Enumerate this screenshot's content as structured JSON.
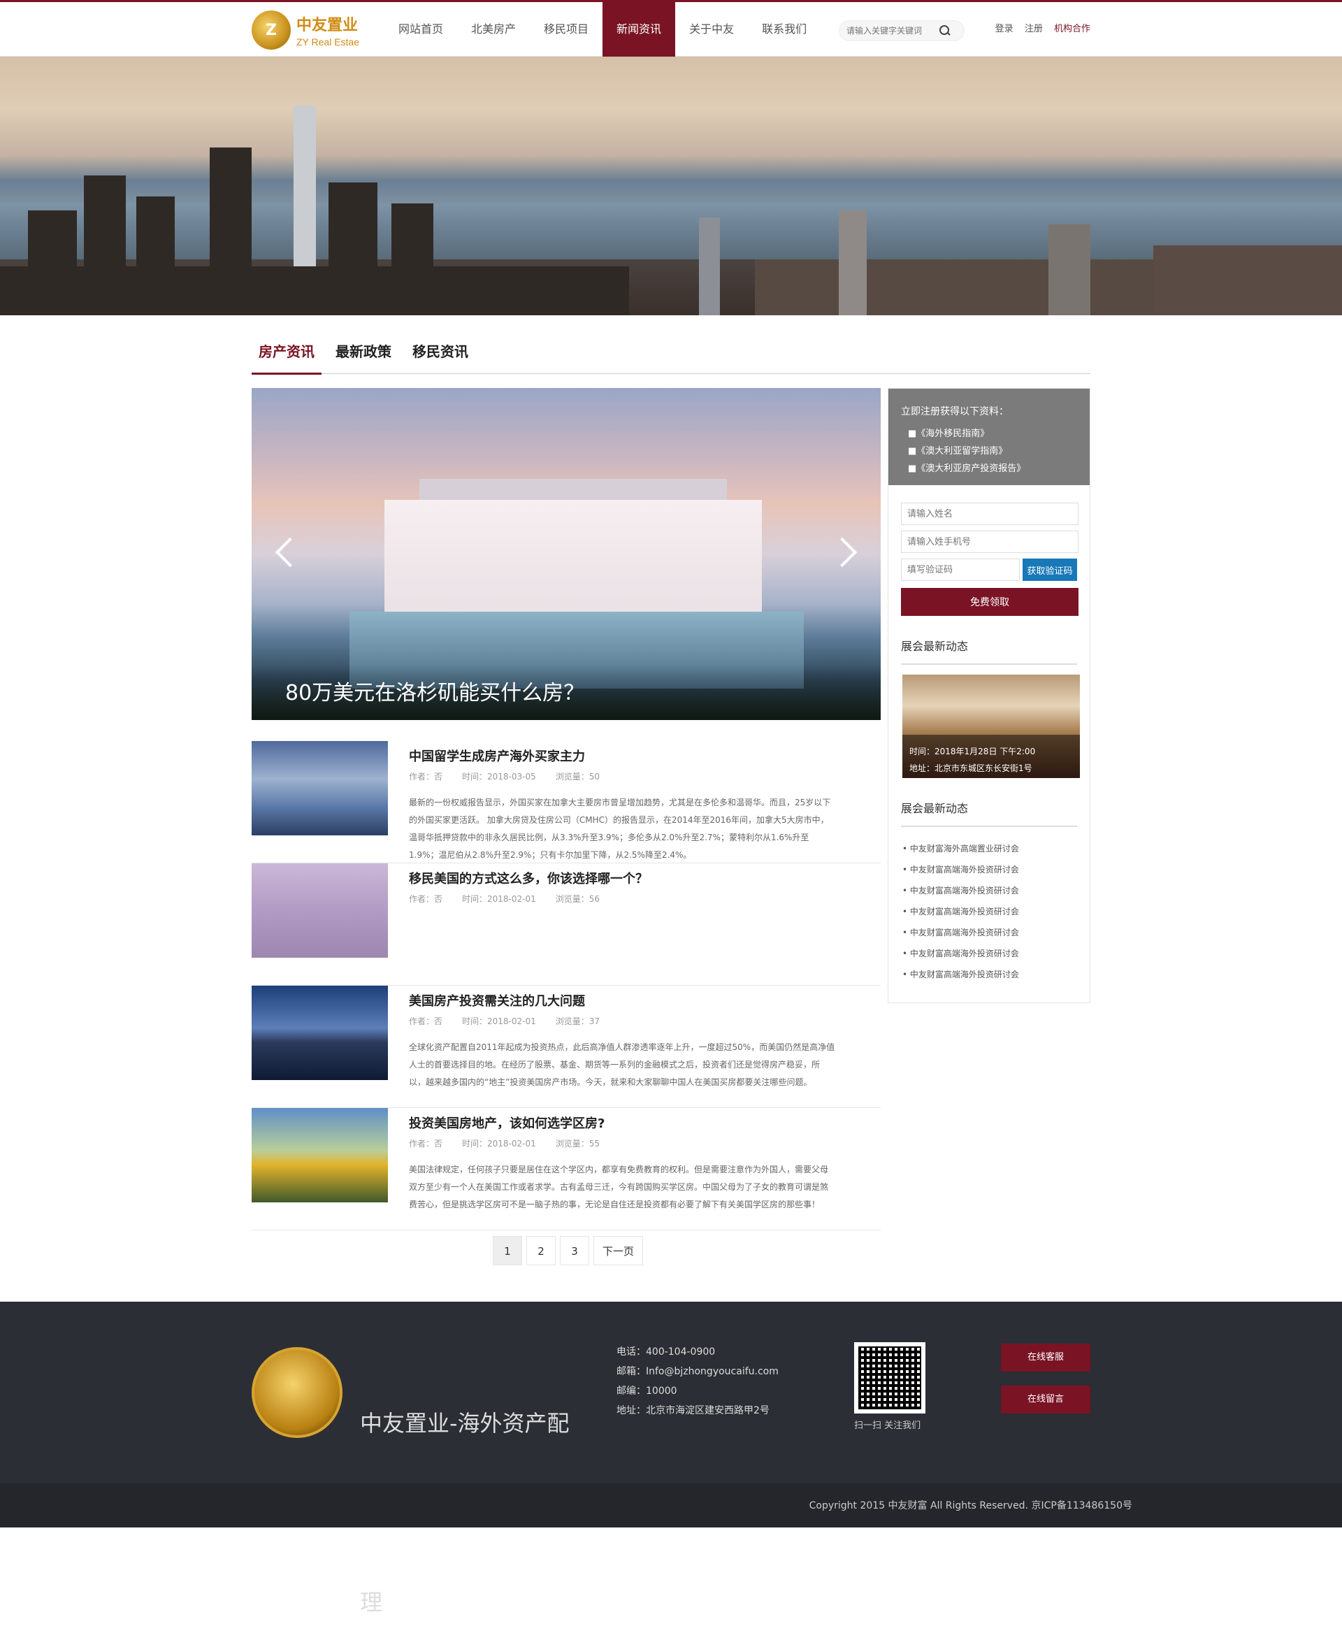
{
  "header": {
    "logo_cn": "中友置业",
    "logo_en": "ZY Real Estae",
    "nav": [
      "网站首页",
      "北美房产",
      "移民项目",
      "新闻资讯",
      "关于中友",
      "联系我们"
    ],
    "search_placeholder": "请输入关键字关键词",
    "login": "登录",
    "register": "注册",
    "partner": "机构合作"
  },
  "tabs": [
    "房产资讯",
    "最新政策",
    "移民资讯"
  ],
  "slider": {
    "caption": "80万美元在洛杉矶能买什么房？"
  },
  "news": [
    {
      "title": "中国留学生成房产海外买家主力",
      "author": "作者：否",
      "date": "时间：2018-03-05",
      "views": "浏览量：50",
      "desc": "最新的一份权威报告显示，外国买家在加拿大主要房市曾呈增加趋势，尤其是在多伦多和温哥华。而且，25岁以下的外国买家更活跃。 加拿大房贷及住房公司（CMHC）的报告显示，在2014年至2016年间，加拿大5大房市中，温哥华抵押贷款中的非永久居民比例，从3.3%升至3.9%；多伦多从2.0%升至2.7%；蒙特利尔从1.6%升至1.9%；温尼伯从2.8%升至2.9%；只有卡尔加里下降，从2.5%降至2.4%。"
    },
    {
      "title": "移民美国的方式这么多，你该选择哪一个？",
      "author": "作者：否",
      "date": "时间：2018-02-01",
      "views": "浏览量：56",
      "desc": ""
    },
    {
      "title": "美国房产投资需关注的几大问题",
      "author": "作者：否",
      "date": "时间：2018-02-01",
      "views": "浏览量：37",
      "desc": "全球化资产配置自2011年起成为投资热点，此后高净值人群渗透率逐年上升，一度超过50%，而美国仍然是高净值人士的首要选择目的地。在经历了股票、基金、期货等一系列的金融模式之后，投资者们还是觉得房产稳妥，所以，越来越多国内的“地主”投资美国房产市场。今天，就来和大家聊聊中国人在美国买房都要关注哪些问题。"
    },
    {
      "title": "投资美国房地产，该如何选学区房?",
      "author": "作者：否",
      "date": "时间：2018-02-01",
      "views": "浏览量：55",
      "desc": "美国法律规定，任何孩子只要是居住在这个学区内，都享有免费教育的权利。但是需要注意作为外国人，需要父母双方至少有一个人在美国工作或者求学。古有孟母三迁，今有跨国购买学区房。中国父母为了子女的教育可谓是煞费苦心，但是挑选学区房可不是一脑子热的事，无论是自住还是投资都有必要了解下有关美国学区房的那些事！"
    }
  ],
  "pager": [
    "1",
    "2",
    "3",
    "下一页"
  ],
  "side": {
    "promo_title": "立即注册获得以下资料：",
    "promo_items": [
      "■《海外移民指南》",
      "■《澳大利亚留学指南》",
      "■《澳大利亚房产投资报告》"
    ],
    "name_placeholder": "请输入姓名",
    "phone_placeholder": "请输入姓手机号",
    "code_placeholder": "填写验证码",
    "code_btn": "获取验证码",
    "submit": "免费领取",
    "expo_title": "展会最新动态",
    "expo_time": "时间：2018年1月28日 下午2:00",
    "expo_addr": "地址：北京市东城区东长安街1号",
    "links_title": "展会最新动态",
    "links": [
      "中友财富海外高端置业研讨会",
      "中友财富高端海外投资研讨会",
      "中友财富高端海外投资研讨会",
      "中友财富高端海外投资研讨会",
      "中友财富高端海外投资研讨会",
      "中友财富高端海外投资研讨会",
      "中友财富高端海外投资研讨会"
    ]
  },
  "footer": {
    "slogan": "中友置业-海外资产配置，移民留学，财富管理",
    "phone": "电话：400-104-0900",
    "email": "邮箱：Info@bjzhongyoucaifu.com",
    "zip": "邮编：10000",
    "addr": "地址：北京市海淀区建安西路甲2号",
    "qr_text": "扫一扫 关注我们",
    "service": "在线客服",
    "message": "在线留言",
    "copyright": "Copyright 2015 中友财富 All Rights Reserved. 京ICP备113486150号"
  }
}
